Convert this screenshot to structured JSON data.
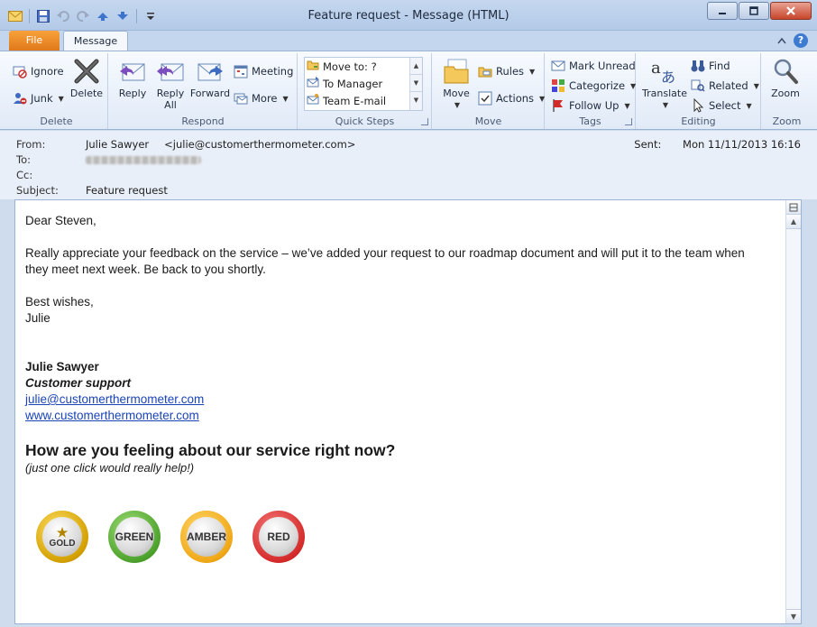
{
  "window": {
    "title": "Feature request  -  Message (HTML)"
  },
  "tabs": {
    "file": "File",
    "message": "Message"
  },
  "ribbon": {
    "delete_group": {
      "label": "Delete",
      "ignore": "Ignore",
      "junk": "Junk",
      "delete": "Delete"
    },
    "respond_group": {
      "label": "Respond",
      "reply": "Reply",
      "reply_all_1": "Reply",
      "reply_all_2": "All",
      "forward": "Forward",
      "meeting": "Meeting",
      "more": "More"
    },
    "quick_steps": {
      "label": "Quick Steps",
      "items": [
        "Move to: ?",
        "To Manager",
        "Team E-mail"
      ]
    },
    "move_group": {
      "label": "Move",
      "move": "Move",
      "rules": "Rules",
      "actions": "Actions"
    },
    "tags_group": {
      "label": "Tags",
      "mark_unread": "Mark Unread",
      "categorize": "Categorize",
      "follow_up": "Follow Up"
    },
    "editing_group": {
      "label": "Editing",
      "translate": "Translate",
      "find": "Find",
      "related": "Related",
      "select": "Select"
    },
    "zoom_group": {
      "label": "Zoom",
      "zoom": "Zoom"
    }
  },
  "header": {
    "from_label": "From:",
    "from_name": "Julie Sawyer",
    "from_email": "<julie@customerthermometer.com>",
    "to_label": "To:",
    "cc_label": "Cc:",
    "subject_label": "Subject:",
    "subject": "Feature request",
    "sent_label": "Sent:",
    "sent_value": "Mon 11/11/2013 16:16"
  },
  "body": {
    "greeting": "Dear Steven,",
    "para1": "Really appreciate your feedback on the service – we’ve added your request to our roadmap document and will put it to the team when",
    "para1b": "they meet next week. Be back to you shortly.",
    "closing": "Best wishes,",
    "closing_name": "Julie",
    "sig_name": "Julie Sawyer",
    "sig_role": "Customer support",
    "sig_email": "julie@customerthermometer.com",
    "sig_web": "www.customerthermometer.com",
    "survey_question": "How are you feeling about our service right now?",
    "survey_hint": "(just one click would really help!)",
    "ratings": {
      "gold": "GOLD",
      "green": "GREEN",
      "amber": "AMBER",
      "red": "RED"
    }
  }
}
